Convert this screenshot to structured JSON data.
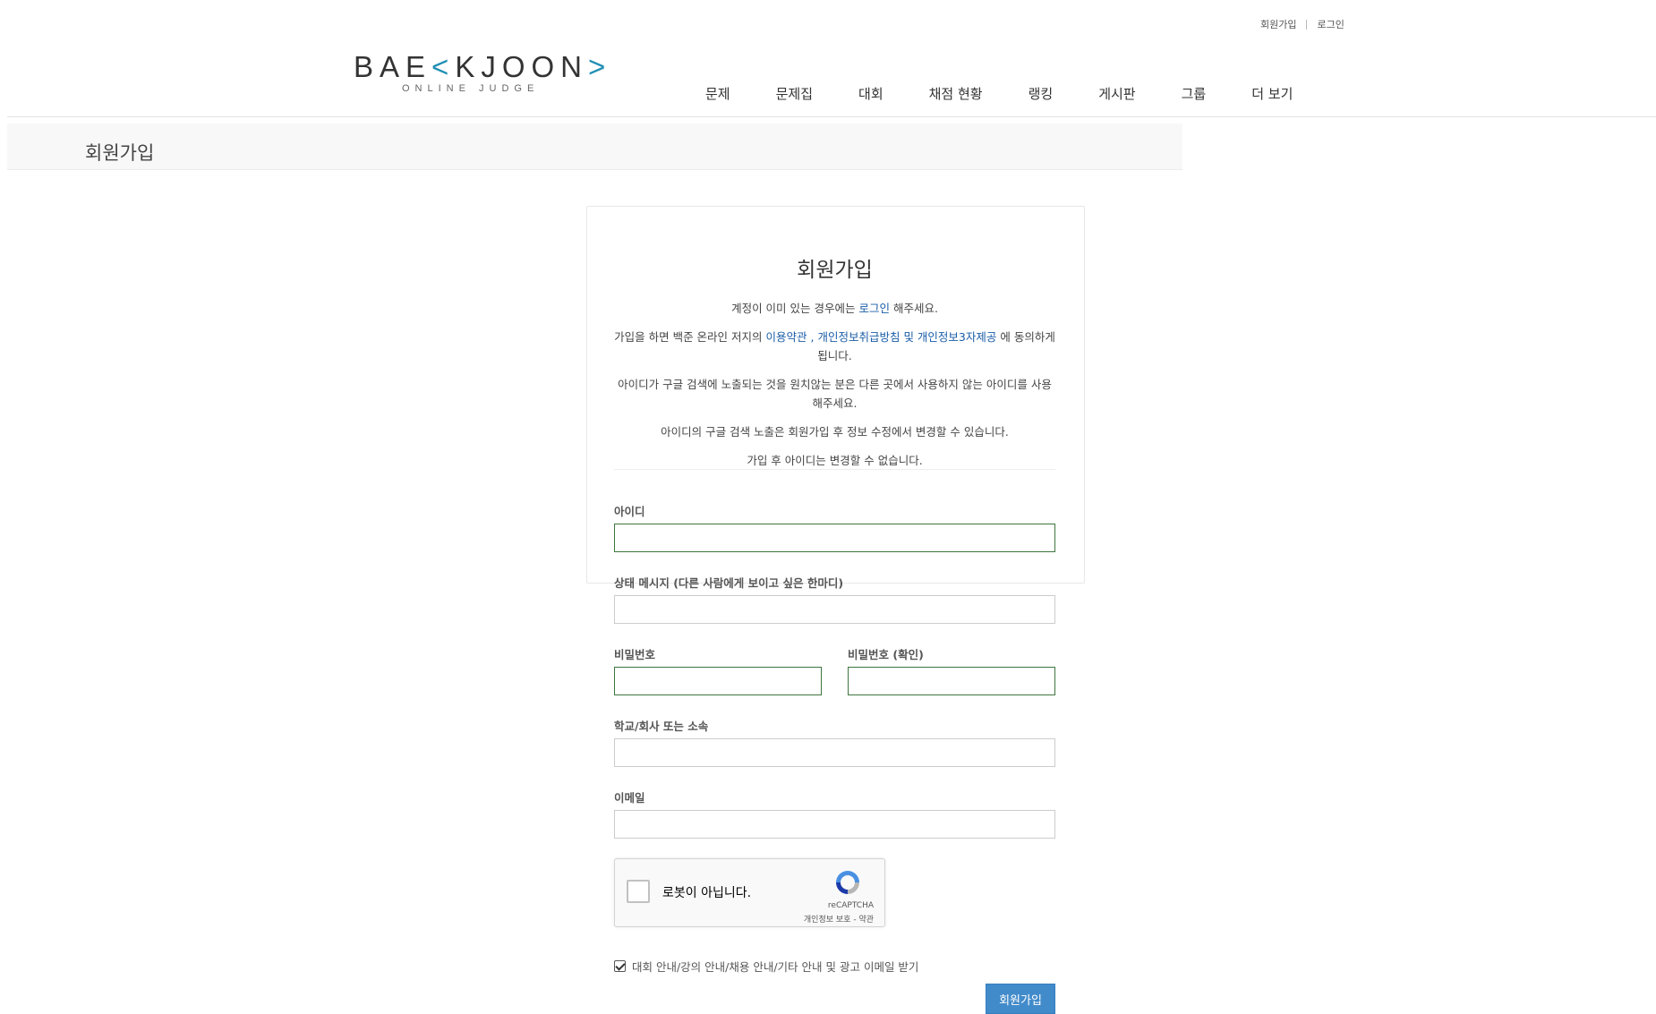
{
  "topbar": {
    "signup_label": "회원가입",
    "login_label": "로그인"
  },
  "logo": {
    "word_left": "BAE",
    "word_accent": "<",
    "word_mid": "KJOON",
    "word_accent2": ">",
    "subtitle": "ONLINE JUDGE"
  },
  "nav": {
    "items": [
      "문제",
      "문제집",
      "대회",
      "채점 현황",
      "랭킹",
      "게시판",
      "그룹",
      "더 보기"
    ]
  },
  "page": {
    "title": "회원가입"
  },
  "card": {
    "heading": "회원가입",
    "line1_pre": "계정이 이미 있는 경우에는 ",
    "line1_link": "로그인",
    "line1_post": " 해주세요.",
    "line2_pre": "가입을 하면 백준 온라인 저지의 ",
    "terms_link": "이용약관",
    "line2_sep1": " , ",
    "privacy_link": "개인정보취급방침",
    "line2_sep2": " 및 ",
    "third_party_link": "개인정보3자제공",
    "line2_post": " 에 동의하게 됩니다.",
    "line3": "아이디가 구글 검색에 노출되는 것을 원치않는 분은 다른 곳에서 사용하지 않는 아이디를 사용해주세요.",
    "line4": "아이디의 구글 검색 노출은 회원가입 후 정보 수정에서 변경할 수 있습니다.",
    "line5": "가입 후 아이디는 변경할 수 없습니다."
  },
  "form": {
    "id_label": "아이디",
    "id_value": "",
    "status_label": "상태 메시지 (다른 사람에게 보이고 싶은 한마디)",
    "status_value": "",
    "password_label": "비밀번호",
    "password_confirm_label": "비밀번호 (확인)",
    "school_label": "학교/회사 또는 소속",
    "school_value": "",
    "email_label": "이메일",
    "email_value": ""
  },
  "recaptcha": {
    "label": "로봇이 아닙니다.",
    "brand": "reCAPTCHA",
    "privacy": "개인정보 보호",
    "dash": " - ",
    "terms": "약관"
  },
  "consent": {
    "label": "대회 안내/강의 안내/채용 안내/기타 안내 및 광고 이메일 받기",
    "checked": true
  },
  "submit": {
    "label": "회원가입"
  },
  "colors": {
    "accent": "#1f8fb3",
    "link": "#1a5da8",
    "valid_border": "#3c763d",
    "button": "#428bca"
  }
}
